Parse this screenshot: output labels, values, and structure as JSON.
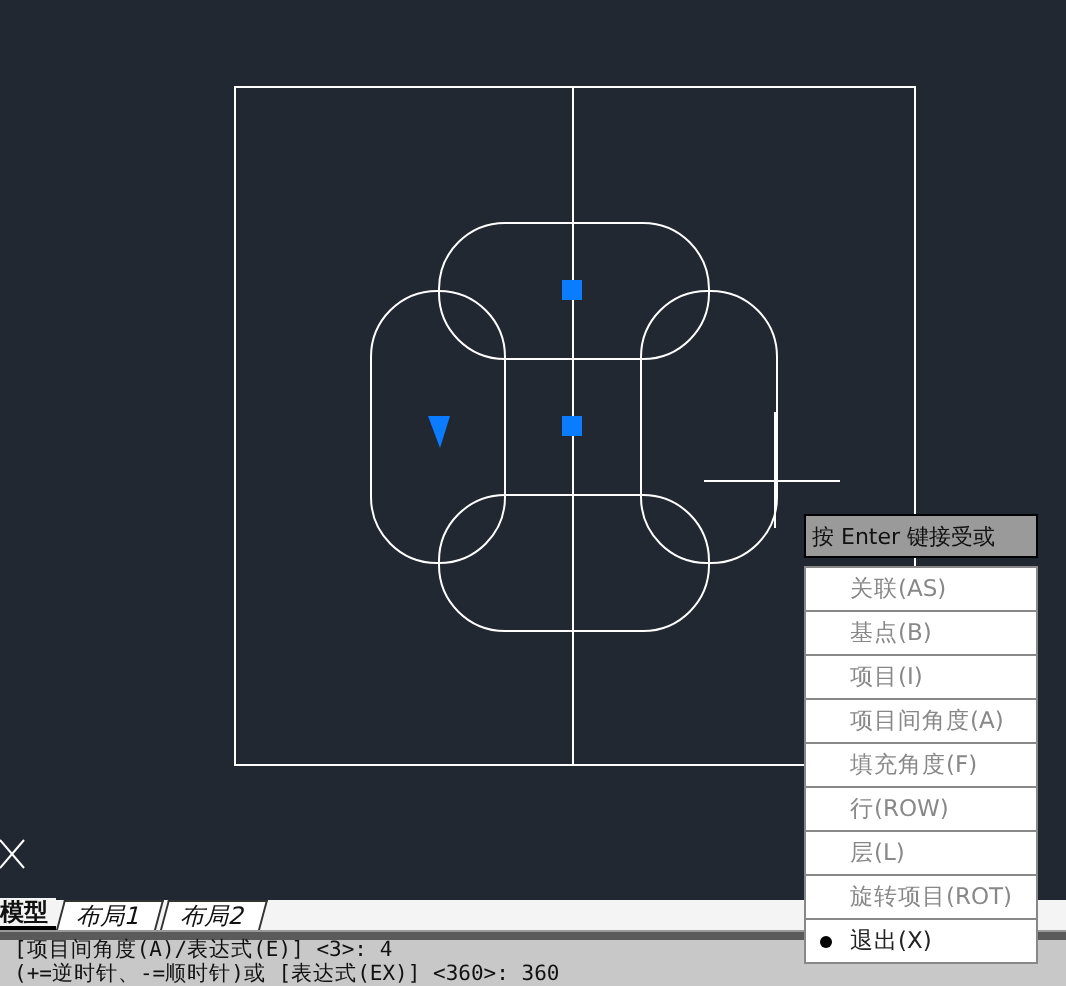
{
  "tabs": [
    {
      "label": "模型",
      "selected": true
    },
    {
      "label": "布局1",
      "selected": false
    },
    {
      "label": "布局2",
      "selected": false
    }
  ],
  "tooltip": "按 Enter 键接受或",
  "context_menu": [
    {
      "label": "关联(AS)",
      "disabled": true,
      "selected": false
    },
    {
      "label": "基点(B)",
      "disabled": true,
      "selected": false
    },
    {
      "label": "项目(I)",
      "disabled": true,
      "selected": false
    },
    {
      "label": "项目间角度(A)",
      "disabled": true,
      "selected": false
    },
    {
      "label": "填充角度(F)",
      "disabled": true,
      "selected": false
    },
    {
      "label": "行(ROW)",
      "disabled": true,
      "selected": false
    },
    {
      "label": "层(L)",
      "disabled": true,
      "selected": false
    },
    {
      "label": "旋转项目(ROT)",
      "disabled": true,
      "selected": false
    },
    {
      "label": "退出(X)",
      "disabled": false,
      "selected": true
    }
  ],
  "command_lines": [
    "[项目间角度(A)/表达式(E)] <3>: 4",
    "(+=逆时针、-=顺时针)或 [表达式(EX)] <360>: 360"
  ]
}
